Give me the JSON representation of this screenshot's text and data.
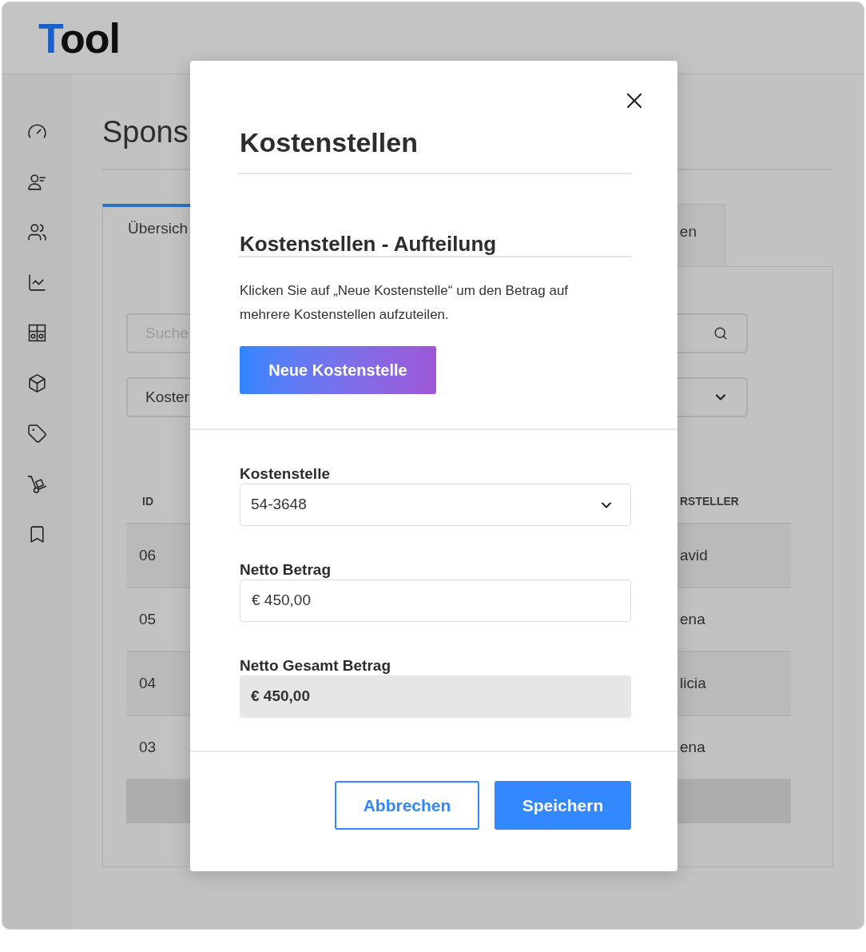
{
  "app": {
    "logo": "Tool"
  },
  "page": {
    "title": "Spons",
    "tabs": [
      {
        "label": "Übersich",
        "selected": true
      },
      {
        "label": "en",
        "selected": false
      }
    ],
    "search": {
      "placeholder": "Suche"
    },
    "filter": {
      "value": "Koster"
    },
    "table": {
      "columns": [
        "ID",
        "RSTELLER"
      ],
      "rows": [
        {
          "cells": [
            "06",
            "avid"
          ]
        },
        {
          "cells": [
            "05",
            "ena"
          ]
        },
        {
          "cells": [
            "04",
            "licia"
          ]
        },
        {
          "cells": [
            "03",
            "ena"
          ]
        }
      ]
    }
  },
  "dialog": {
    "title": "Kostenstellen",
    "section_title": "Kostenstellen - Aufteilung",
    "description": "Klicken Sie auf „Neue Kostenstelle“ um den Betrag auf mehrere Kostenstellen aufzuteilen.",
    "add_button": "Neue Kostenstelle",
    "fields": [
      {
        "kind": "select",
        "label": "Kostenstelle",
        "value": "54-3648"
      },
      {
        "kind": "input",
        "label": "Netto Betrag",
        "value": "€ 450,00"
      },
      {
        "kind": "readonly",
        "label": "Netto Gesamt Betrag",
        "value": "€ 450,00"
      }
    ],
    "buttons": [
      {
        "kind": "secondary",
        "label": "Abbrechen"
      },
      {
        "kind": "primary",
        "label": "Speichern"
      }
    ]
  }
}
